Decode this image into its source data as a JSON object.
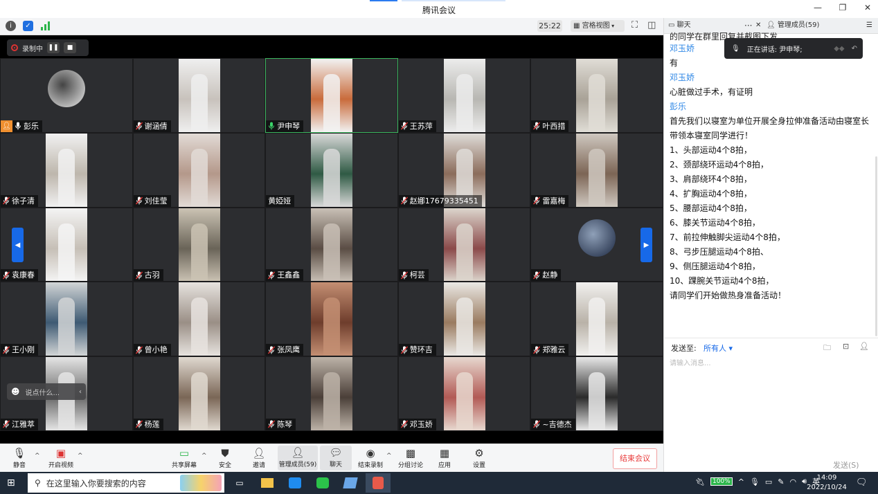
{
  "window": {
    "title": "腾讯会议",
    "minimize": "—",
    "restore": "❐",
    "close": "✕"
  },
  "toolbar": {
    "timer": "25:22",
    "grid_view": "宫格视图"
  },
  "recording": {
    "label": "录制中",
    "pause": "❚❚",
    "stop": "■"
  },
  "participants": [
    {
      "name": "彭乐",
      "type": "avatar",
      "host": true,
      "mic": "on",
      "colors": [
        "#eaeaea",
        "#444"
      ]
    },
    {
      "name": "谢涵倩",
      "type": "video",
      "mic": "muted",
      "colors": [
        "#c8c2bc",
        "#efefef"
      ]
    },
    {
      "name": "尹申琴",
      "type": "video",
      "mic": "speaking",
      "active": true,
      "colors": [
        "#c96b3b",
        "#f2f2f2"
      ]
    },
    {
      "name": "王苏萍",
      "type": "video",
      "mic": "muted",
      "colors": [
        "#b8b7b2",
        "#ececec"
      ]
    },
    {
      "name": "叶西措",
      "type": "video",
      "mic": "muted",
      "colors": [
        "#a9a297",
        "#e0ddd6"
      ]
    },
    {
      "name": "徐子清",
      "type": "video",
      "mic": "muted",
      "colors": [
        "#bdb6ac",
        "#f1f1f1"
      ]
    },
    {
      "name": "刘佳莹",
      "type": "video",
      "mic": "muted",
      "colors": [
        "#b4988a",
        "#e2dbd6"
      ]
    },
    {
      "name": "黄婭娅",
      "type": "video",
      "mic": "none",
      "colors": [
        "#2f5a44",
        "#d9d9d9"
      ]
    },
    {
      "name": "赵娜17679335451",
      "type": "video",
      "mic": "muted",
      "colors": [
        "#8b6c5b",
        "#dfdcd8"
      ]
    },
    {
      "name": "雷嘉梅",
      "type": "video",
      "mic": "muted",
      "colors": [
        "#7c6555",
        "#cfc8c0"
      ]
    },
    {
      "name": "袁康春",
      "type": "video",
      "mic": "muted",
      "colors": [
        "#c6bfb6",
        "#f4f4f4"
      ]
    },
    {
      "name": "古羽",
      "type": "video",
      "mic": "muted",
      "colors": [
        "#6a6458",
        "#cbc3b4"
      ]
    },
    {
      "name": "王鑫鑫",
      "type": "video",
      "mic": "muted",
      "colors": [
        "#5a4d44",
        "#c9c0b6"
      ]
    },
    {
      "name": "柯芸",
      "type": "video",
      "mic": "muted",
      "colors": [
        "#8b4a4a",
        "#dcd5cc"
      ]
    },
    {
      "name": "赵静",
      "type": "avatar",
      "mic": "muted",
      "colors": [
        "#1b2740",
        "#8fa0b8"
      ]
    },
    {
      "name": "王小刚",
      "type": "video",
      "mic": "muted",
      "colors": [
        "#3e5a73",
        "#d2d5d6"
      ]
    },
    {
      "name": "曾小艳",
      "type": "video",
      "mic": "muted",
      "colors": [
        "#9a8f86",
        "#e7e3df"
      ]
    },
    {
      "name": "张凤鹰",
      "type": "video",
      "mic": "muted",
      "colors": [
        "#6e3d2c",
        "#c48f73"
      ]
    },
    {
      "name": "赞环吉",
      "type": "video",
      "mic": "muted",
      "colors": [
        "#9a7b60",
        "#eae8e4"
      ]
    },
    {
      "name": "郑雅云",
      "type": "video",
      "mic": "muted",
      "colors": [
        "#b9b2a8",
        "#f1f0ee"
      ]
    },
    {
      "name": "江雅萃",
      "type": "video",
      "mic": "muted",
      "colors": [
        "#6a6a6a",
        "#e5e5e5"
      ]
    },
    {
      "name": "杨莲",
      "type": "video",
      "mic": "muted",
      "colors": [
        "#7a6656",
        "#e0d9d0"
      ]
    },
    {
      "name": "陈琴",
      "type": "video",
      "mic": "muted",
      "colors": [
        "#4a3f38",
        "#bdb3a8"
      ]
    },
    {
      "name": "邓玉娇",
      "type": "video",
      "mic": "muted",
      "colors": [
        "#b25a55",
        "#e7d8cf"
      ]
    },
    {
      "name": "~吉德杰",
      "type": "video",
      "mic": "muted",
      "colors": [
        "#2a2a2a",
        "#e8e8e8"
      ]
    }
  ],
  "chat_input_overlay": "说点什么...",
  "bottom": {
    "mute": "静音",
    "video": "开启视频",
    "share": "共享屏幕",
    "security": "安全",
    "invite": "邀请",
    "members": "管理成员(59)",
    "chat": "聊天",
    "end_record": "结束录制",
    "breakout": "分组讨论",
    "apps": "应用",
    "settings": "设置",
    "end_meeting": "结束会议"
  },
  "panel": {
    "tab_chat": "聊天",
    "tab_members": "管理成员(59)",
    "speaking": "正在讲话: 尹申琴;",
    "clipped_top": "的同学在群里回复并截图下发",
    "messages": [
      {
        "sender": "邓玉娇",
        "lines": [
          "有"
        ]
      },
      {
        "sender": "邓玉娇",
        "lines": [
          "心脏做过手术，有证明"
        ]
      },
      {
        "sender": "彭乐",
        "lines": [
          "首先我们以寝室为单位开展全身拉伸准备活动由寝室长",
          "带领本寝室同学进行！",
          "1、头部运动4个8拍，",
          "2、颈部绕环运动4个8拍，",
          "3、肩部绕环4个8拍，",
          "4、扩胸运动4个8拍，",
          "5、腰部运动4个8拍，",
          "6、膝关节运动4个8拍，",
          "7、前拉伸触脚尖运动4个8拍，",
          "8、弓步压腿运动4个8拍、",
          "9、侧压腿运动4个8拍，",
          "10、踝腕关节运动4个8拍，",
          "请同学们开始做热身准备活动！"
        ]
      }
    ],
    "send_to_label": "发送至:",
    "send_to_value": "所有人",
    "input_placeholder": "请输入消息...",
    "send": "发送(S)"
  },
  "taskbar": {
    "search_placeholder": "在这里输入你要搜索的内容",
    "battery": "100%",
    "lang": "英",
    "time": "14:09",
    "date": "2022/10/24"
  }
}
